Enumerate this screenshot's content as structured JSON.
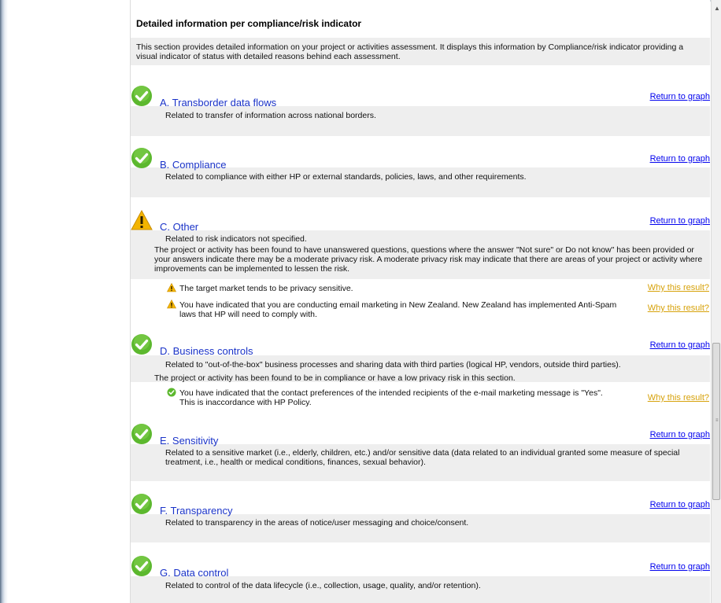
{
  "header": {
    "title": "Detailed information per compliance/risk indicator"
  },
  "intro": "This section provides detailed information on your project or activities assessment. It displays this information by Compliance/risk indicator providing a visual indicator of status with detailed reasons behind each assessment.",
  "return_label": "Return to graph",
  "why_label": "Why this result?",
  "colors": {
    "link": "#0000ee",
    "title": "#1a33c8",
    "why": "#d7a20a",
    "ok": "#5cb82e",
    "warn": "#f3b400",
    "band": "#eeeeee"
  },
  "sections": [
    {
      "title": "A. Transborder data flows",
      "status": "check-icon",
      "desc": "Related to transfer of information across national borders."
    },
    {
      "title": "B. Compliance",
      "status": "check-icon",
      "desc": "Related to compliance with either HP or external standards, policies, laws, and other requirements."
    },
    {
      "title": "C. Other",
      "status": "warning-icon",
      "desc": "Related to risk indicators not specified.",
      "para": "The project or activity has been found to have unanswered questions, questions where the answer \"Not sure\" or Do not know\" has been provided or your answers indicate there may be a moderate privacy risk. A moderate privacy risk may indicate that there are areas of your project or activity where improvements can be implemented to lessen the risk.",
      "items": [
        {
          "text": "The target market tends to be privacy sensitive."
        },
        {
          "text": "You have indicated that you are conducting email marketing in New Zealand. New Zealand has implemented Anti-Spam laws that HP will need to comply with."
        }
      ]
    },
    {
      "title": "D. Business controls",
      "status": "check-icon",
      "desc": "Related to \"out-of-the-box\" business processes and sharing data with third parties (logical HP, vendors, outside third parties).",
      "para": "The project or activity has been found to be in compliance or have a low privacy risk in this section.",
      "items": [
        {
          "text": "You have indicated that the contact preferences of the intended recipients of the e-mail marketing message is \"Yes\". This is inaccordance with HP Policy."
        }
      ]
    },
    {
      "title": "E. Sensitivity",
      "status": "check-icon",
      "desc": "Related to a sensitive market (i.e., elderly, children, etc.) and/or sensitive data (data related to an individual granted some measure of special treatment, i.e., health or medical conditions, finances, sexual behavior)."
    },
    {
      "title": "F. Transparency",
      "status": "check-icon",
      "desc": "Related to transparency in the areas of notice/user messaging and choice/consent."
    },
    {
      "title": "G. Data control",
      "status": "check-icon",
      "desc": "Related to control of the data lifecycle (i.e., collection, usage, quality, and/or retention)."
    }
  ]
}
